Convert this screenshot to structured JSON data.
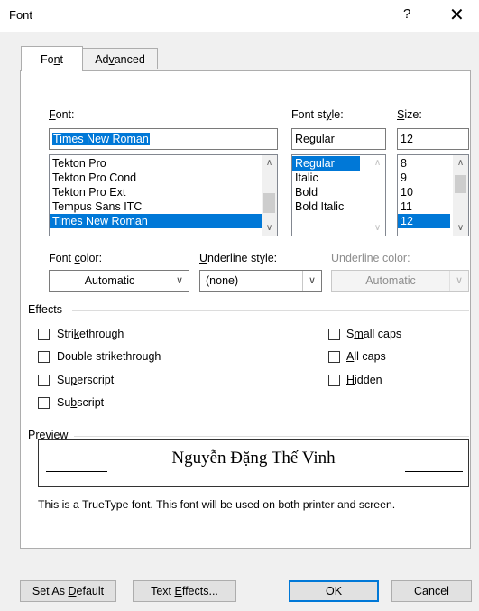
{
  "window": {
    "title": "Font",
    "help_glyph": "?",
    "close_glyph": "✕"
  },
  "tabs": [
    {
      "label_pre": "Fo",
      "label_u": "n",
      "label_post": "t"
    },
    {
      "label_pre": "Ad",
      "label_u": "v",
      "label_post": "anced"
    }
  ],
  "font": {
    "label_u": "F",
    "label_post": "ont:",
    "value": "Times New Roman",
    "items": [
      "Tekton Pro",
      "Tekton Pro Cond",
      "Tekton Pro Ext",
      "Tempus Sans ITC",
      "Times New Roman"
    ],
    "selected": "Times New Roman"
  },
  "style": {
    "label_pre": "Font st",
    "label_u": "y",
    "label_post": "le:",
    "value": "Regular",
    "items": [
      "Regular",
      "Italic",
      "Bold",
      "Bold Italic"
    ],
    "selected": "Regular"
  },
  "size": {
    "label_u": "S",
    "label_post": "ize:",
    "value": "12",
    "items": [
      "8",
      "9",
      "10",
      "11",
      "12"
    ],
    "selected": "12"
  },
  "font_color": {
    "label_pre": "Font ",
    "label_u": "c",
    "label_post": "olor:",
    "value": "Automatic"
  },
  "underline_style": {
    "label_u": "U",
    "label_post": "nderline style:",
    "value": "(none)"
  },
  "underline_color": {
    "label": "Underline color:",
    "value": "Automatic"
  },
  "effects": {
    "heading": "Effects",
    "left": [
      {
        "pre": "Stri",
        "u": "k",
        "post": "ethrough"
      },
      {
        "pre": "Double strikethrou",
        "u": "g",
        "post": "h"
      },
      {
        "pre": "Su",
        "u": "p",
        "post": "erscript"
      },
      {
        "pre": "Su",
        "u": "b",
        "post": "script"
      }
    ],
    "right": [
      {
        "pre": "S",
        "u": "m",
        "post": "all caps"
      },
      {
        "pre": "",
        "u": "A",
        "post": "ll caps"
      },
      {
        "pre": "",
        "u": "H",
        "post": "idden"
      }
    ]
  },
  "preview": {
    "heading": "Preview",
    "sample": "Nguyễn Đặng Thế Vinh",
    "note": "This is a TrueType font. This font will be used on both printer and screen."
  },
  "buttons": {
    "set_default": {
      "pre": "Set As ",
      "u": "D",
      "post": "efault"
    },
    "text_effects": {
      "pre": "Text ",
      "u": "E",
      "post": "ffects..."
    },
    "ok": "OK",
    "cancel": "Cancel"
  }
}
